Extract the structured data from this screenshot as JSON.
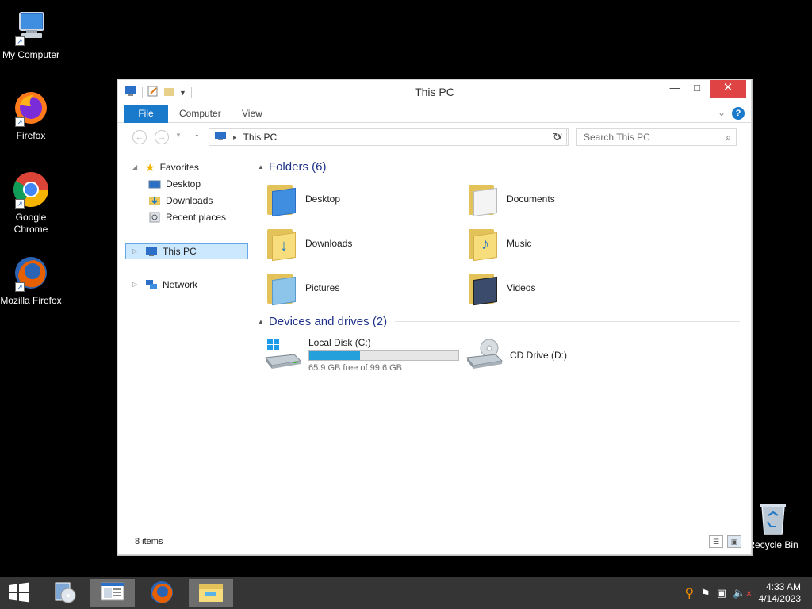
{
  "desktop": {
    "icons": [
      {
        "label": "My Computer"
      },
      {
        "label": "Firefox"
      },
      {
        "label": "Google Chrome"
      },
      {
        "label": "Mozilla Firefox"
      },
      {
        "label": "Recycle Bin"
      }
    ]
  },
  "window": {
    "title": "This PC",
    "minimize": "—",
    "maximize": "□",
    "close": "✕"
  },
  "ribbon": {
    "tabs": [
      "File",
      "Computer",
      "View"
    ],
    "help": "?",
    "expand": "⌄"
  },
  "nav": {
    "back": "←",
    "forward": "→",
    "up": "↑",
    "address_crumb": "This PC",
    "address_separator": "▸",
    "dropdown": "∨",
    "refresh": "↻",
    "search_placeholder": "Search This PC",
    "search_icon": "⌕"
  },
  "navpane": {
    "favorites": "Favorites",
    "desktop": "Desktop",
    "downloads": "Downloads",
    "recent": "Recent places",
    "this_pc": "This PC",
    "network": "Network"
  },
  "content": {
    "folders_header": "Folders (6)",
    "folders": [
      {
        "name": "Desktop",
        "icon": "desktop-folder-icon"
      },
      {
        "name": "Documents",
        "icon": "documents-folder-icon"
      },
      {
        "name": "Downloads",
        "icon": "downloads-folder-icon"
      },
      {
        "name": "Music",
        "icon": "music-folder-icon"
      },
      {
        "name": "Pictures",
        "icon": "pictures-folder-icon"
      },
      {
        "name": "Videos",
        "icon": "videos-folder-icon"
      }
    ],
    "devices_header": "Devices and drives (2)",
    "drives": [
      {
        "name": "Local Disk (C:)",
        "free": "65.9 GB free of 99.6 GB",
        "used_fraction": 0.338
      },
      {
        "name": "CD Drive (D:)"
      }
    ]
  },
  "status": {
    "items": "8 items"
  },
  "taskbar": {
    "time": "4:33 AM",
    "date": "4/14/2023"
  },
  "colors": {
    "accent": "#1979ca",
    "close": "#e04343",
    "progress": "#26a0da",
    "taskbar": "#353535"
  }
}
